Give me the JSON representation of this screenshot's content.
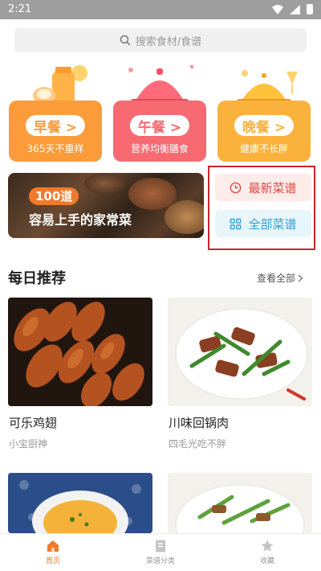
{
  "status_bar": {
    "time": "2:21"
  },
  "search": {
    "placeholder": "搜索食材/食谱"
  },
  "meals": [
    {
      "label": "早餐 >",
      "subtitle": "365天不重样",
      "color": "#fb9b3a"
    },
    {
      "label": "午餐 >",
      "subtitle": "营养均衡膳食",
      "color": "#f76a72"
    },
    {
      "label": "晚餐 >",
      "subtitle": "健康不长胖",
      "color": "#fbb23d"
    }
  ],
  "banner": {
    "badge": "100道",
    "title": "容易上手的家常菜"
  },
  "quick_links": {
    "latest": "最新菜谱",
    "all": "全部菜谱"
  },
  "section": {
    "title": "每日推荐",
    "view_all": "查看全部"
  },
  "recipes": [
    {
      "name": "可乐鸡翅",
      "author": "小宝厨神"
    },
    {
      "name": "川味回锅肉",
      "author": "四毛光吃不胖"
    }
  ],
  "tabs": [
    {
      "label": "首页",
      "icon": "home-icon",
      "active": true
    },
    {
      "label": "菜谱分类",
      "icon": "category-icon",
      "active": false
    },
    {
      "label": "收藏",
      "icon": "star-icon",
      "active": false
    }
  ],
  "colors": {
    "accent": "#f07a2c",
    "highlight": "#c8252c",
    "latest_text": "#e2483f",
    "all_text": "#2d9fd8"
  }
}
